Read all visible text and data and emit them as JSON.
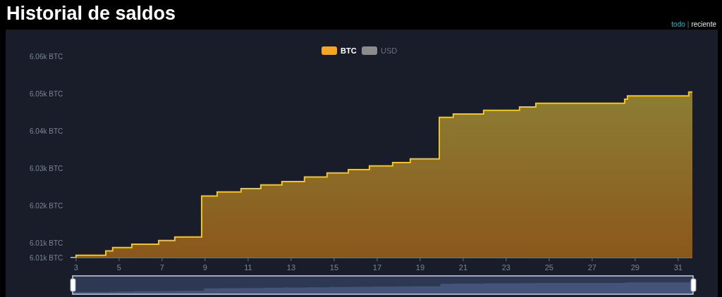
{
  "title": "Historial de saldos",
  "range_separator": "|",
  "range_links": [
    {
      "label": "todo",
      "selected": true
    },
    {
      "label": "reciente",
      "selected": false
    }
  ],
  "chart": {
    "legend": [
      {
        "label": "BTC",
        "color": "#f5a623",
        "selected": true
      },
      {
        "label": "USD",
        "color": "#8c8c8c",
        "selected": false
      }
    ],
    "chart_data": {
      "type": "area",
      "x": [
        2.74,
        3,
        4.38,
        4.7,
        5.59,
        6.84,
        7.59,
        8.84,
        9.56,
        10.67,
        11.59,
        12.57,
        13.62,
        14.67,
        15.66,
        16.64,
        17.72,
        18.54,
        19.89,
        20.54,
        21.95,
        23.62,
        24.38,
        28.51,
        28.64,
        31.49,
        31.66
      ],
      "series": [
        {
          "color": "#f5c518",
          "values": [
            6.006,
            6.0066,
            6.0078,
            6.0087,
            6.0096,
            6.0106,
            6.0115,
            6.0225,
            6.0236,
            6.0245,
            6.0255,
            6.0264,
            6.0276,
            6.0287,
            6.0296,
            6.0306,
            6.0315,
            6.0325,
            6.0436,
            6.0445,
            6.0455,
            6.0464,
            6.0474,
            6.0485,
            6.0494,
            6.0504,
            6.0504
          ]
        }
      ],
      "xlim": [
        2.74,
        31.66
      ],
      "ylim": [
        6.006,
        6.06
      ],
      "xticks": [
        3,
        5,
        7,
        9,
        11,
        13,
        15,
        17,
        19,
        21,
        23,
        25,
        27,
        29,
        31
      ],
      "yticks": [
        {
          "value": 6.06,
          "label": "6.06k BTC"
        },
        {
          "value": 6.05,
          "label": "6.05k BTC"
        },
        {
          "value": 6.04,
          "label": "6.04k BTC"
        },
        {
          "value": 6.03,
          "label": "6.03k BTC"
        },
        {
          "value": 6.02,
          "label": "6.02k BTC"
        },
        {
          "value": 6.01,
          "label": "6.01k BTC"
        },
        {
          "value": 6.006,
          "label": "6.01k BTC"
        }
      ]
    }
  }
}
